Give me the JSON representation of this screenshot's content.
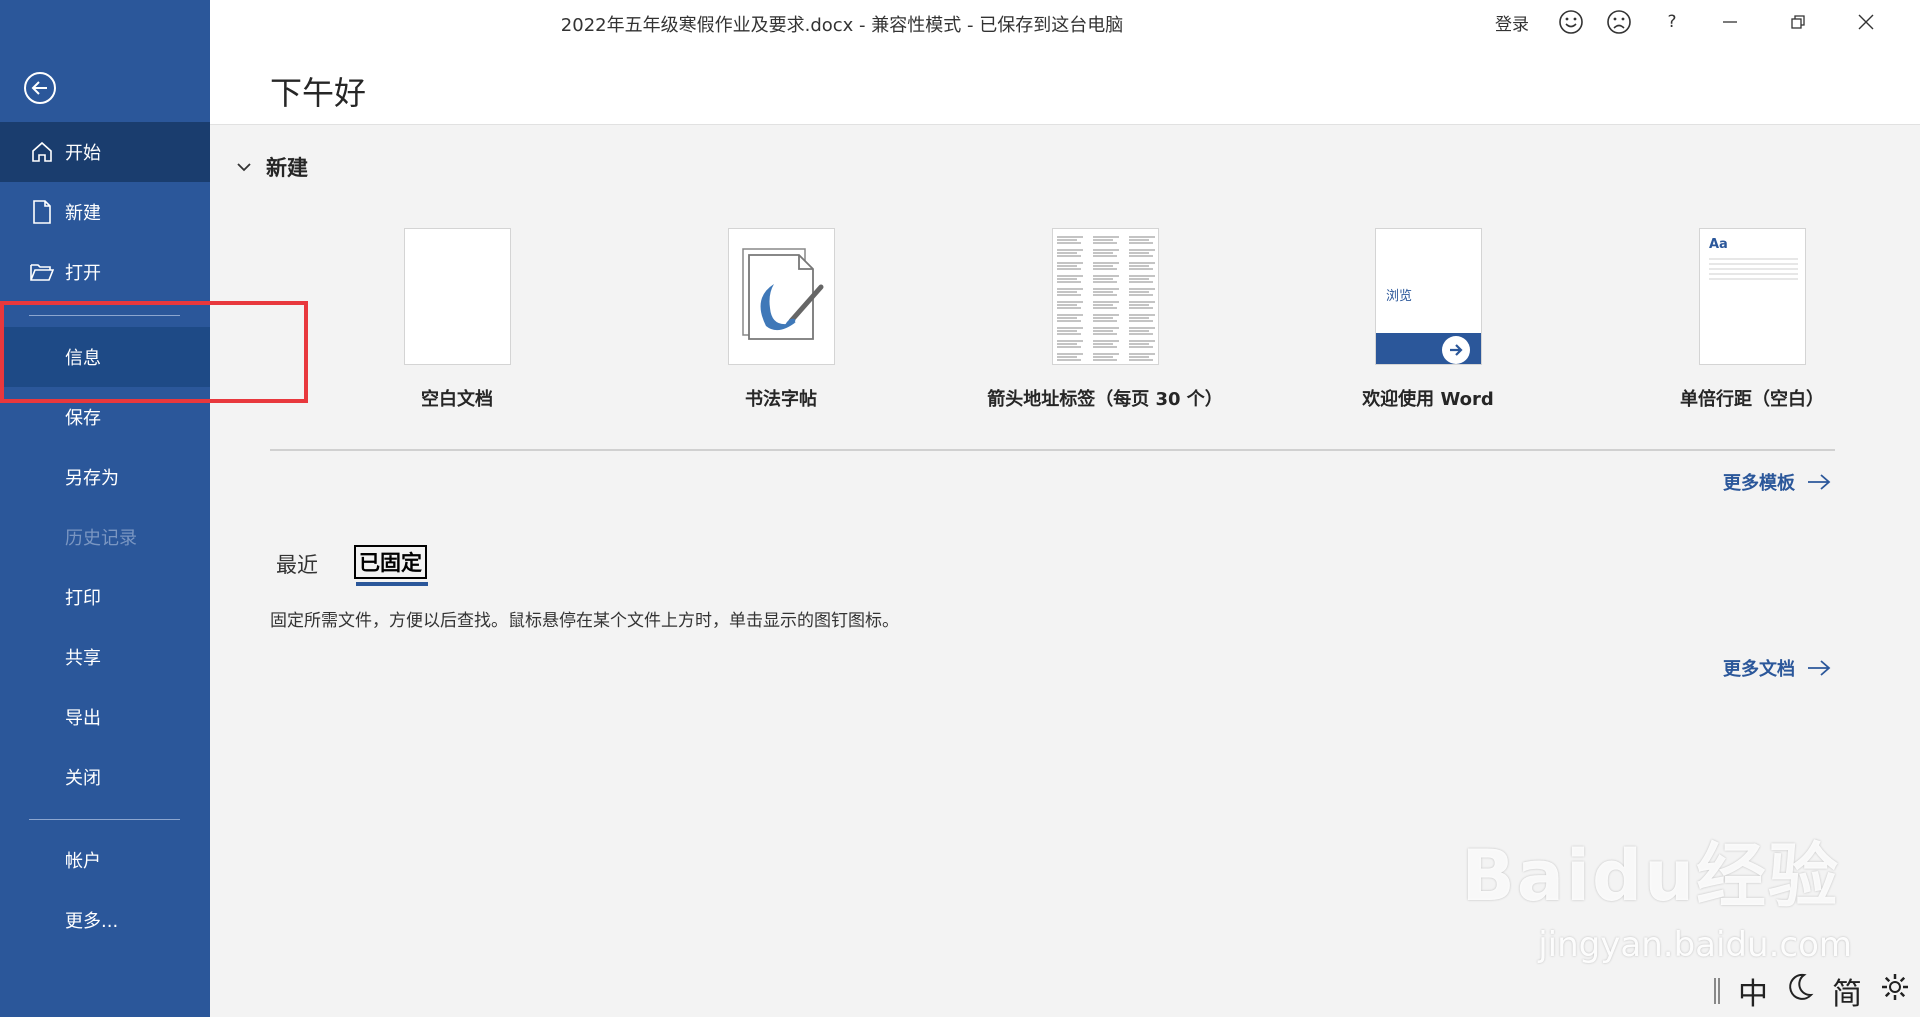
{
  "title_bar": {
    "doc_title": "2022年五年级寒假作业及要求.docx  -  兼容性模式  -  已保存到这台电脑",
    "login": "登录",
    "help": "?"
  },
  "sidebar": {
    "items": [
      {
        "label": "开始",
        "icon": "home-icon"
      },
      {
        "label": "新建",
        "icon": "new-document-icon"
      },
      {
        "label": "打开",
        "icon": "folder-open-icon"
      },
      {
        "label": "信息"
      },
      {
        "label": "保存"
      },
      {
        "label": "另存为"
      },
      {
        "label": "历史记录"
      },
      {
        "label": "打印"
      },
      {
        "label": "共享"
      },
      {
        "label": "导出"
      },
      {
        "label": "关闭"
      },
      {
        "label": "帐户"
      },
      {
        "label": "更多..."
      }
    ]
  },
  "greeting": "下午好",
  "new_section": {
    "heading": "新建",
    "templates": [
      {
        "label": "空白文档"
      },
      {
        "label": "书法字帖"
      },
      {
        "label": "箭头地址标签（每页 30 个）"
      },
      {
        "label": "欢迎使用 Word",
        "thumb_text": "浏览"
      },
      {
        "label": "单倍行距（空白）",
        "thumb_text": "Aa"
      }
    ],
    "more_templates": "更多模板"
  },
  "tabs": {
    "recent": "最近",
    "pinned": "已固定",
    "active": "pinned"
  },
  "pinned_hint": "固定所需文件，方便以后查找。鼠标悬停在某个文件上方时，单击显示的图钉图标。",
  "more_documents": "更多文档",
  "ime_bar": {
    "mode": "中",
    "script": "简"
  },
  "watermark": {
    "brand": "Bai",
    "brand_tail": "du",
    "cn": "经验",
    "url": "jingyan.baidu.com"
  },
  "colors": {
    "sidebar": "#2b579a",
    "sidebar_active": "#1a3d6e",
    "accent": "#2b579a",
    "highlight": "#e8383d"
  }
}
